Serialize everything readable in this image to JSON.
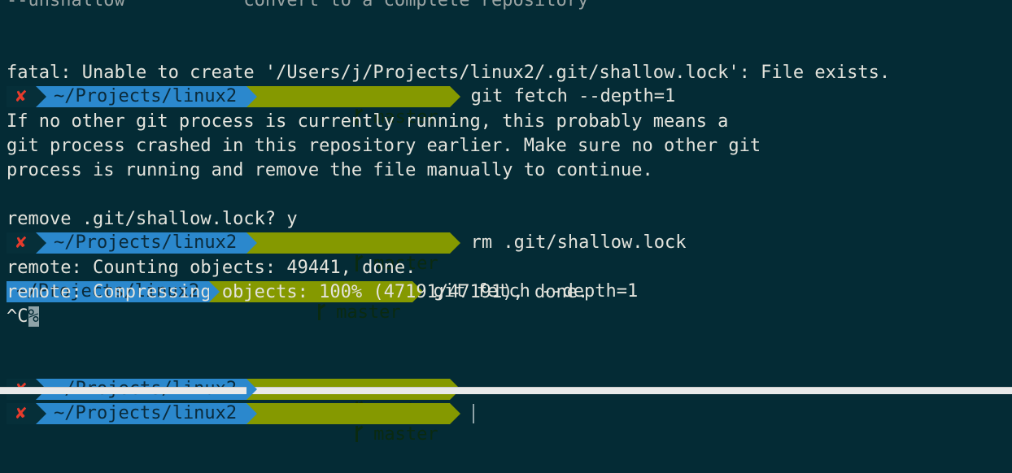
{
  "header_cut_line": "--unshallow           convert to a complete repository",
  "err_mark": "✘",
  "prompt_dir": "~/Projects/linux2",
  "prompt_branch": "master",
  "commands": {
    "fetch_1": "git fetch --depth=1",
    "rm_lock": "rm .git/shallow.lock",
    "fetch_2": "git fetch --depth=1"
  },
  "output": {
    "fatal": "fatal: Unable to create '/Users/j/Projects/linux2/.git/shallow.lock': File exists.",
    "if_no_other": "If no other git process is currently running, this probably means a",
    "git_process": "git process crashed in this repository earlier. Make sure no other git",
    "process_running": "process is running and remove the file manually to continue.",
    "remove_prompt": "remove .git/shallow.lock? y",
    "counting": "remote: Counting objects: 49441, done.",
    "compressing": "remote: Compressing objects: 100% (47191/47191), done.",
    "ctrl_c": "^C",
    "percent": "%"
  },
  "colors": {
    "background": "#042b35",
    "dir_segment": "#2b88cd",
    "git_segment": "#859900",
    "error_mark": "#e53b2c"
  }
}
